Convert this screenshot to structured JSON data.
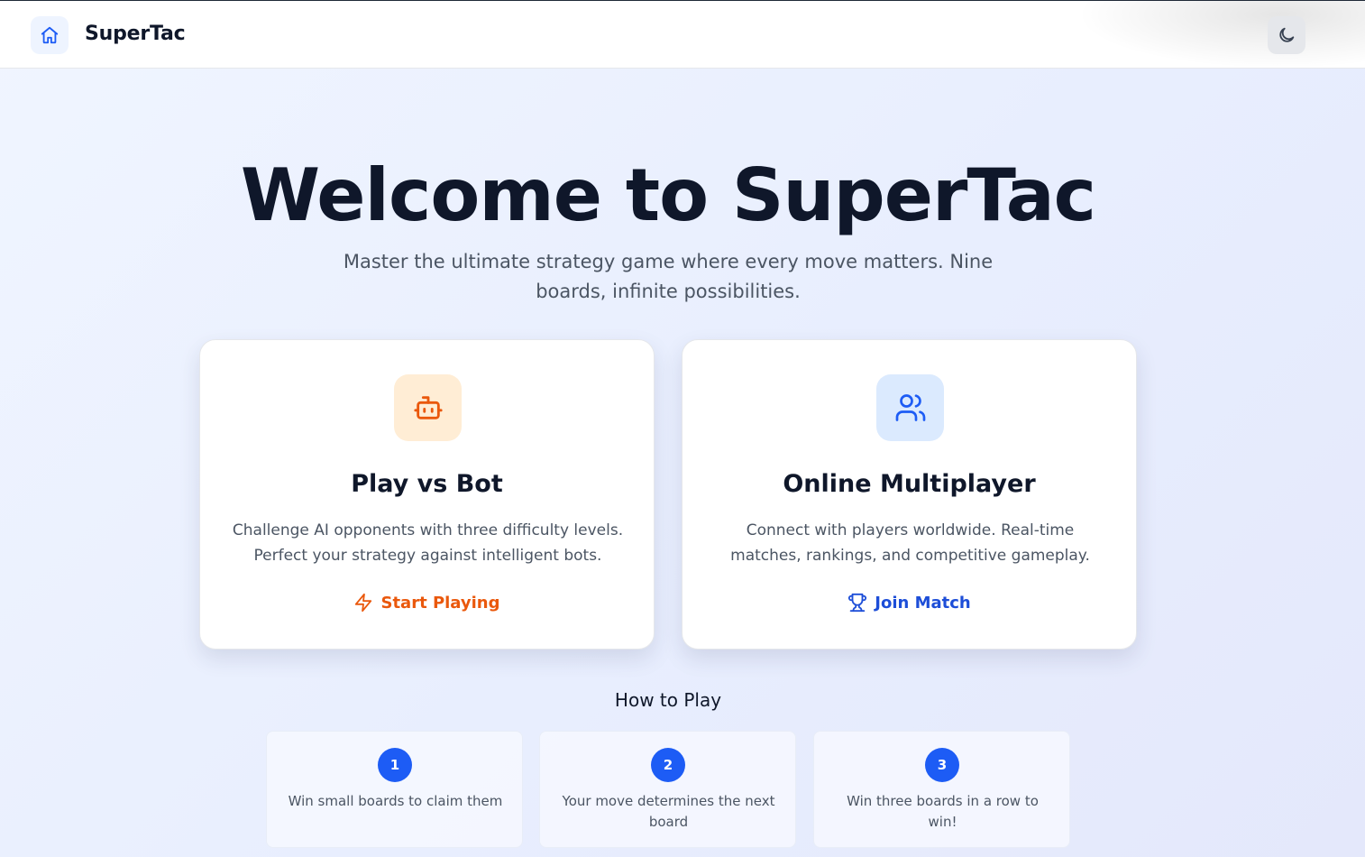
{
  "header": {
    "brand": "SuperTac",
    "home_icon": "home-icon",
    "theme_icon": "moon-icon"
  },
  "hero": {
    "title": "Welcome to SuperTac",
    "subtitle": "Master the ultimate strategy game where every move matters. Nine boards, infinite possibilities."
  },
  "cards": [
    {
      "icon": "bot-icon",
      "title": "Play vs Bot",
      "description": "Challenge AI opponents with three difficulty levels. Perfect your strategy against intelligent bots.",
      "action_icon": "lightning-icon",
      "action_label": "Start Playing",
      "accent": "#ea580c"
    },
    {
      "icon": "users-icon",
      "title": "Online Multiplayer",
      "description": "Connect with players worldwide. Real-time matches, rankings, and competitive gameplay.",
      "action_icon": "trophy-icon",
      "action_label": "Join Match",
      "accent": "#1d4ed8"
    }
  ],
  "how_to_play": {
    "title": "How to Play",
    "steps": [
      {
        "number": "1",
        "text": "Win small boards to claim them"
      },
      {
        "number": "2",
        "text": "Your move determines the next board"
      },
      {
        "number": "3",
        "text": "Win three boards in a row to win!"
      }
    ]
  },
  "colors": {
    "primary": "#1d5cf5",
    "orange": "#ea580c",
    "text": "#0f172a",
    "muted": "#4b5563"
  }
}
